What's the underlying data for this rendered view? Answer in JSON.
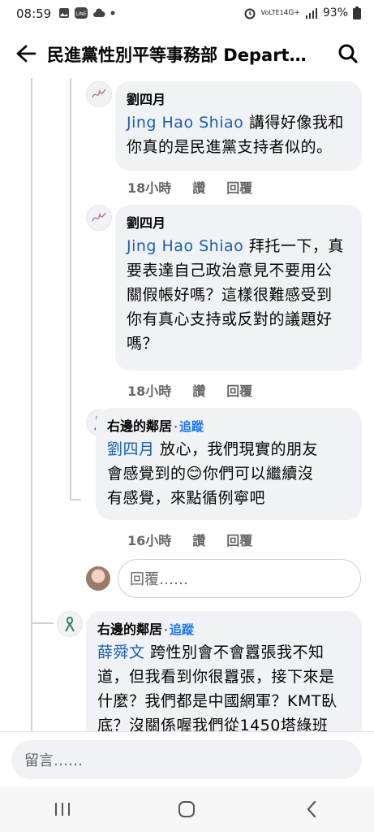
{
  "status_bar": {
    "time": "08:59",
    "network_label": "VoLTE1",
    "signal_label": "4G+",
    "battery": "93%"
  },
  "app_bar": {
    "title": "民進黨性別平等事務部 Departme…"
  },
  "comments": [
    {
      "author": "劉四月",
      "mention": "Jing Hao Shiao",
      "text_line1_rest": " 講得好像我和",
      "text_lines": [
        "你真的是民進黨支持者似的。"
      ],
      "time": "18小時",
      "like": "讚",
      "reply": "回覆"
    },
    {
      "author": "劉四月",
      "mention": "Jing Hao Shiao",
      "text_line1_rest": " 拜托一下，真",
      "text_lines": [
        "要表達自己政治意見不要用公",
        "關假帳好嗎？這樣很難感受到",
        "你有真心支持或反對的議題好",
        "嗎？"
      ],
      "time": "18小時",
      "like": "讚",
      "reply": "回覆"
    },
    {
      "author": "右邊的鄰居",
      "follow": "追蹤",
      "mention": "劉四月",
      "text_line1_rest": " 放心，我們現實的朋友",
      "text_line2a": "會感覺到的",
      "emoji": "😊",
      "text_line2b": "你們可以繼續沒",
      "text_lines": [
        "有感覺，來點循例寧吧"
      ],
      "time": "16小時",
      "like": "讚",
      "reply": "回覆"
    }
  ],
  "reply_box": {
    "placeholder": "回覆……"
  },
  "next_comment": {
    "author": "右邊的鄰居",
    "follow": "追蹤",
    "mention": "薛舜文",
    "text_line1_rest": " 跨性別會不會囂張我不知",
    "text_lines": [
      "道，但我看到你很囂張，接下來是",
      "什麼？我們都是中國網軍？KMT臥",
      "底？沒關係喔我們從1450塔綠班"
    ]
  },
  "composer": {
    "placeholder": "留言……"
  },
  "colors": {
    "accent": "#1877f2",
    "bubble": "#f0f2f5",
    "meta": "#65676b"
  }
}
